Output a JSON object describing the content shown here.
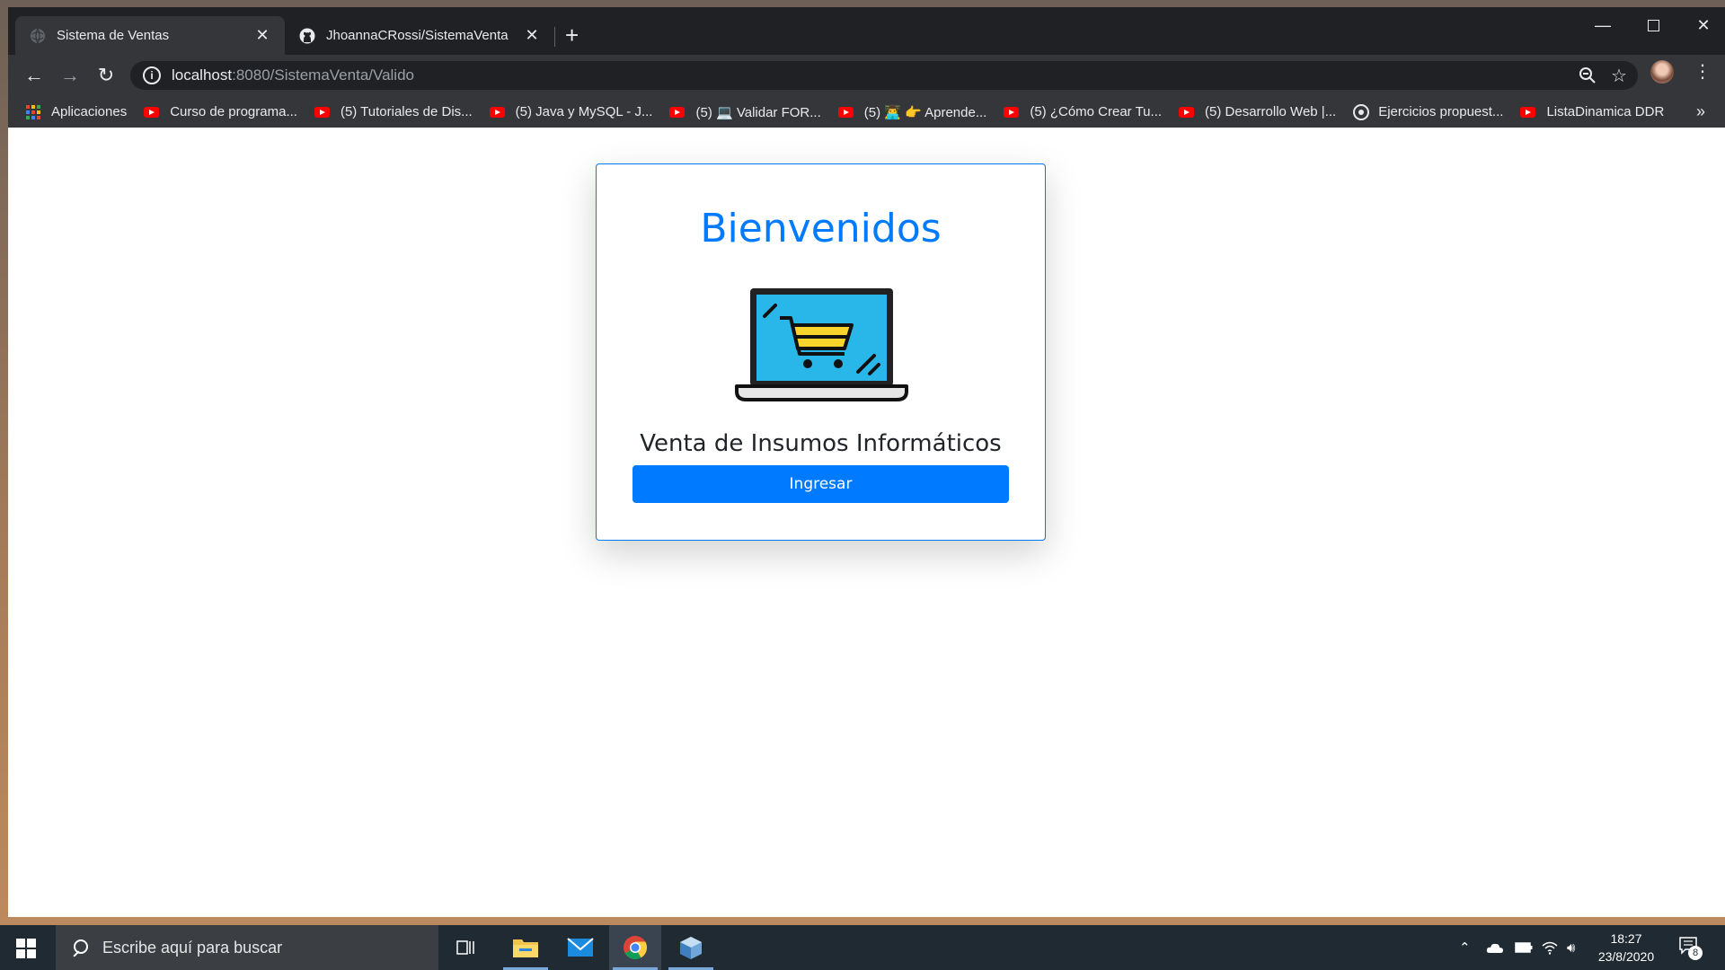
{
  "browser": {
    "tabs": [
      {
        "title": "Sistema de Ventas",
        "icon": "globe-icon",
        "active": true
      },
      {
        "title": "JhoannaCRossi/SistemaVenta",
        "icon": "github-icon",
        "active": false
      }
    ],
    "address": {
      "host": "localhost",
      "path": ":8080/SistemaVenta/Valido"
    },
    "bookmarks": [
      {
        "label": "Aplicaciones",
        "icon": "apps-grid-icon"
      },
      {
        "label": "Curso de programa...",
        "icon": "youtube-icon"
      },
      {
        "label": "(5) Tutoriales de Dis...",
        "icon": "youtube-icon"
      },
      {
        "label": "(5) Java y MySQL - J...",
        "icon": "youtube-icon"
      },
      {
        "label": "(5) 💻 Validar FOR...",
        "icon": "youtube-icon"
      },
      {
        "label": "(5) 👨‍💻 👉 Aprende...",
        "icon": "youtube-icon"
      },
      {
        "label": "(5) ¿Cómo Crear Tu...",
        "icon": "youtube-icon"
      },
      {
        "label": "(5) Desarrollo Web |...",
        "icon": "youtube-icon"
      },
      {
        "label": "Ejercicios propuest...",
        "icon": "eye-icon"
      },
      {
        "label": "ListaDinamica DDR",
        "icon": "youtube-icon"
      }
    ]
  },
  "page": {
    "heading": "Bienvenidos",
    "image_icon": "laptop-cart-icon",
    "subtitle": "Venta de Insumos Informáticos",
    "button_label": "Ingresar",
    "accent_color": "#007bff"
  },
  "taskbar": {
    "search_placeholder": "Escribe aquí para buscar",
    "time": "18:27",
    "date": "23/8/2020",
    "notification_count": "8"
  }
}
